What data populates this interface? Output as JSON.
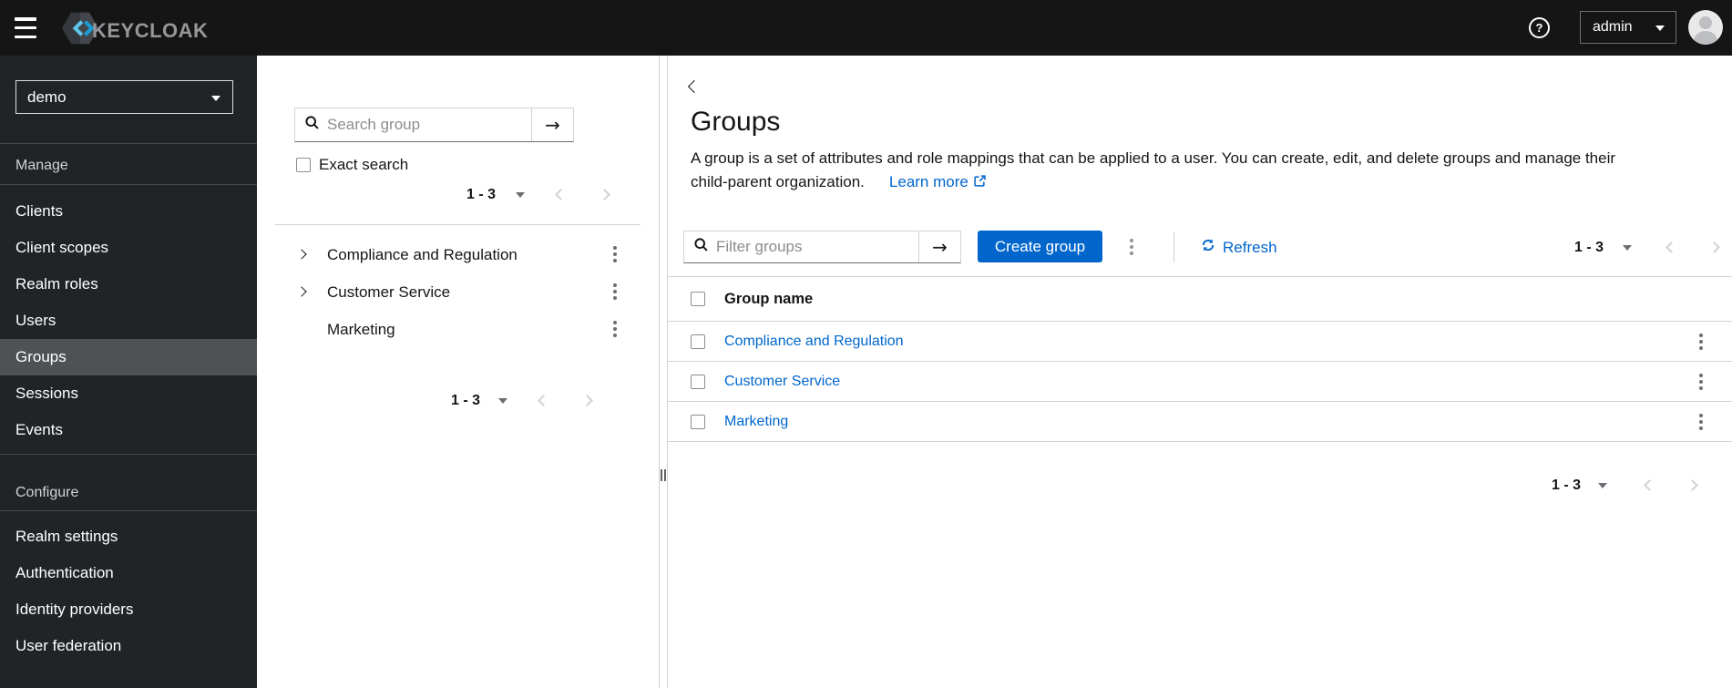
{
  "header": {
    "brand": "KEYCLOAK",
    "help": "?",
    "username": "admin"
  },
  "sidebar": {
    "realm": "demo",
    "sections": [
      {
        "label": "Manage",
        "items": [
          {
            "label": "Clients"
          },
          {
            "label": "Client scopes"
          },
          {
            "label": "Realm roles"
          },
          {
            "label": "Users"
          },
          {
            "label": "Groups",
            "selected": true
          },
          {
            "label": "Sessions"
          },
          {
            "label": "Events"
          }
        ]
      },
      {
        "label": "Configure",
        "items": [
          {
            "label": "Realm settings"
          },
          {
            "label": "Authentication"
          },
          {
            "label": "Identity providers"
          },
          {
            "label": "User federation"
          }
        ]
      }
    ]
  },
  "tree_panel": {
    "search_placeholder": "Search group",
    "exact_search_label": "Exact search",
    "top_pagination": "1 - 3",
    "bottom_pagination": "1 - 3",
    "groups": [
      {
        "label": "Compliance and Regulation",
        "expandable": true
      },
      {
        "label": "Customer Service",
        "expandable": true
      },
      {
        "label": "Marketing",
        "expandable": false
      }
    ]
  },
  "main": {
    "title": "Groups",
    "description_line1": "A group is a set of attributes and role mappings that can be applied to a user. You can create, edit, and delete groups and manage their",
    "description_line2": "child-parent organization.",
    "learn_more": "Learn more",
    "toolbar": {
      "filter_placeholder": "Filter groups",
      "create_label": "Create group",
      "refresh_label": "Refresh",
      "pagination": "1 - 3"
    },
    "table": {
      "header": "Group name",
      "rows": [
        {
          "name": "Compliance and Regulation"
        },
        {
          "name": "Customer Service"
        },
        {
          "name": "Marketing"
        }
      ]
    },
    "bottom_pagination": "1 - 3"
  },
  "colors": {
    "accent_blue": "#0066cc",
    "masthead_bg": "#151515",
    "sidebar_bg": "#212427",
    "selected_nav_bg": "#4f5255",
    "border_gray": "#d2d2d2",
    "text_dark": "#151515"
  }
}
